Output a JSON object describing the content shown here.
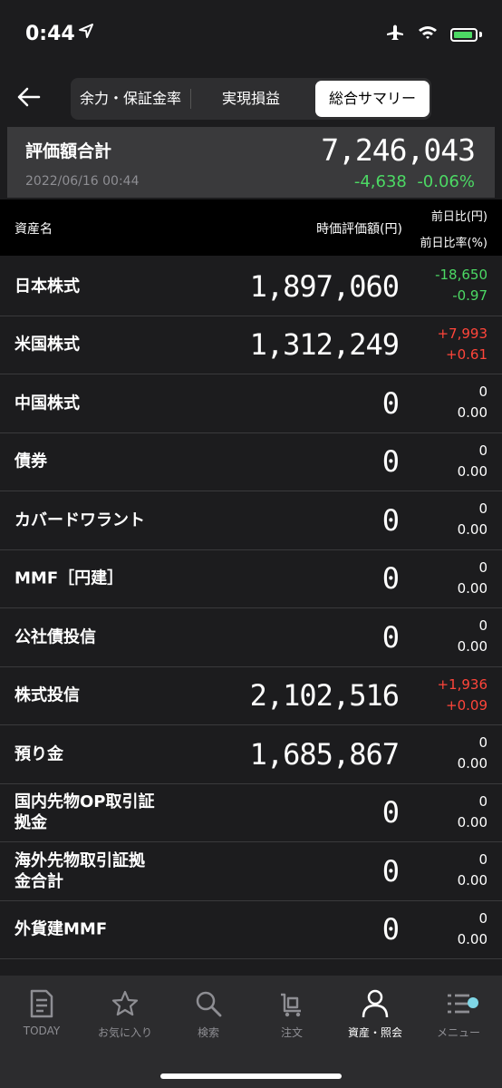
{
  "status": {
    "time": "0:44"
  },
  "nav": {
    "tabs": [
      {
        "label": "余力・保証金率",
        "active": false
      },
      {
        "label": "実現損益",
        "active": false
      },
      {
        "label": "総合サマリー",
        "active": true
      }
    ]
  },
  "summary": {
    "label": "評価額合計",
    "date": "2022/06/16 00:44",
    "value": "7,246,043",
    "change": "-4,638  -0.06%"
  },
  "header": {
    "asset": "資産名",
    "value": "時価評価額(円)",
    "change1": "前日比(円)",
    "change2": "前日比率(%)"
  },
  "rows": [
    {
      "name": "日本株式",
      "value": "1,897,060",
      "c1": "-18,650",
      "c2": "-0.97",
      "dir": "neg"
    },
    {
      "name": "米国株式",
      "value": "1,312,249",
      "c1": "+7,993",
      "c2": "+0.61",
      "dir": "pos"
    },
    {
      "name": "中国株式",
      "value": "0",
      "c1": "0",
      "c2": "0.00",
      "dir": "zero"
    },
    {
      "name": "債券",
      "value": "0",
      "c1": "0",
      "c2": "0.00",
      "dir": "zero"
    },
    {
      "name": "カバードワラント",
      "value": "0",
      "c1": "0",
      "c2": "0.00",
      "dir": "zero"
    },
    {
      "name": "MMF［円建］",
      "value": "0",
      "c1": "0",
      "c2": "0.00",
      "dir": "zero"
    },
    {
      "name": "公社債投信",
      "value": "0",
      "c1": "0",
      "c2": "0.00",
      "dir": "zero"
    },
    {
      "name": "株式投信",
      "value": "2,102,516",
      "c1": "+1,936",
      "c2": "+0.09",
      "dir": "pos"
    },
    {
      "name": "預り金",
      "value": "1,685,867",
      "c1": "0",
      "c2": "0.00",
      "dir": "zero"
    },
    {
      "name": "国内先物OP取引証\n拠金",
      "value": "0",
      "c1": "0",
      "c2": "0.00",
      "dir": "zero"
    },
    {
      "name": "海外先物取引証拠\n金合計",
      "value": "0",
      "c1": "0",
      "c2": "0.00",
      "dir": "zero"
    },
    {
      "name": "外貨建MMF",
      "value": "0",
      "c1": "0",
      "c2": "0.00",
      "dir": "zero"
    }
  ],
  "tabbar": [
    {
      "label": "TODAY",
      "icon": "document-icon",
      "active": false
    },
    {
      "label": "お気に入り",
      "icon": "star-icon",
      "active": false
    },
    {
      "label": "検索",
      "icon": "search-icon",
      "active": false
    },
    {
      "label": "注文",
      "icon": "cart-icon",
      "active": false
    },
    {
      "label": "資産・照会",
      "icon": "person-icon",
      "active": true
    },
    {
      "label": "メニュー",
      "icon": "menu-icon",
      "active": false
    }
  ],
  "colors": {
    "negative": "#4cd964",
    "positive": "#ff453a",
    "background": "#1c1c1e"
  }
}
